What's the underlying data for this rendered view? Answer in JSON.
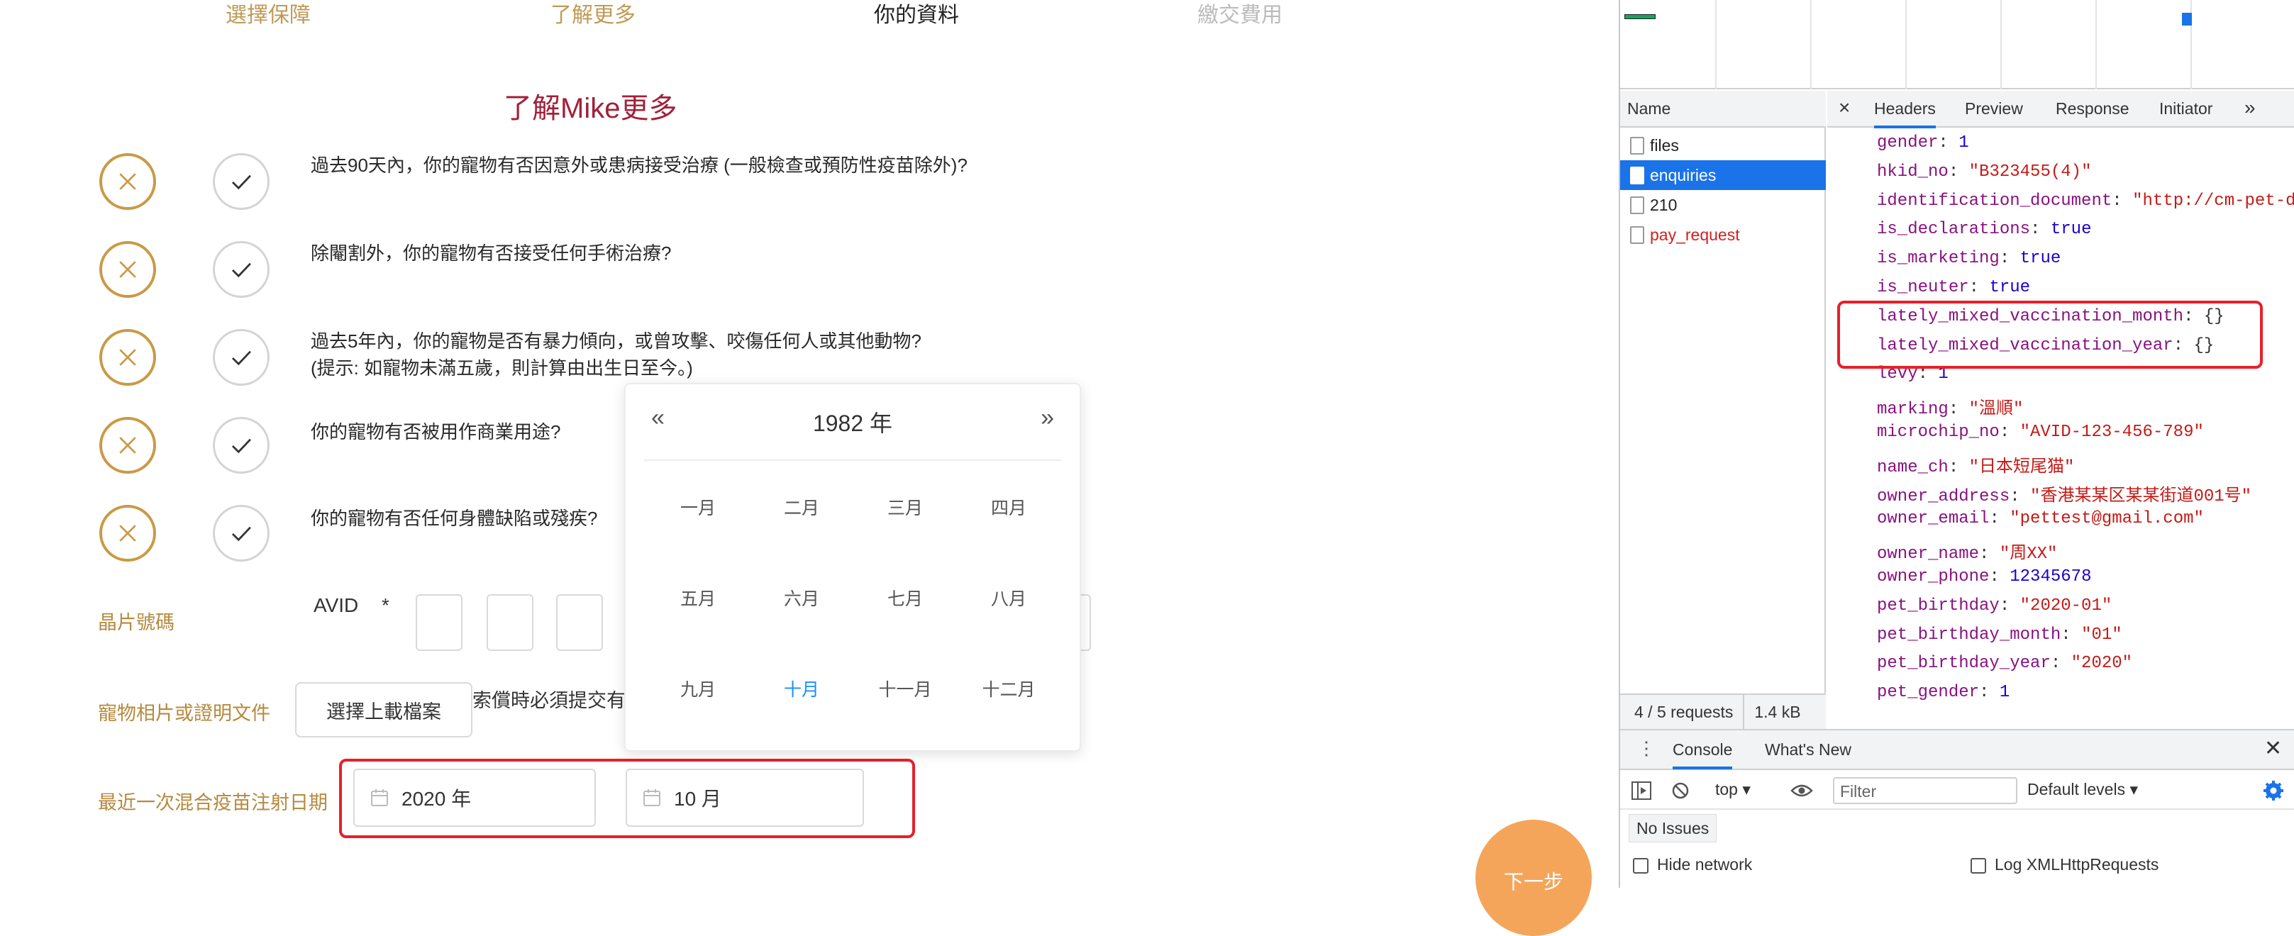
{
  "steps": [
    {
      "label": "選擇保障",
      "color": "#c09a56"
    },
    {
      "label": "了解更多",
      "color": "#c09a56"
    },
    {
      "label": "你的資料",
      "color": "#222222"
    },
    {
      "label": "繳交費用",
      "color": "#bbbbbb"
    }
  ],
  "section_title": "了解Mike更多",
  "questions": [
    {
      "line1": "過去90天內，你的寵物有否因意外或患病接受治療 (一般檢查或預防性疫苗除外)?"
    },
    {
      "line1": "除閹割外，你的寵物有否接受任何手術治療?"
    },
    {
      "line1": "過去5年內，你的寵物是否有暴力傾向，或曾攻擊、咬傷任何人或其他動物?",
      "line2": "(提示: 如寵物未滿五歲，則計算由出生日至今。)"
    },
    {
      "line1": "你的寵物有否被用作商業用途?"
    },
    {
      "line1": "你的寵物有否任何身體缺陷或殘疾?"
    }
  ],
  "fields": {
    "chip_label": "晶片號碼",
    "chip_prefix": "AVID",
    "chip_required": "*",
    "photo_label": "寵物相片或證明文件",
    "upload_button": "選擇上載檔案",
    "upload_note": "索償時必須提交有",
    "vaccine_label": "最近一次混合疫苗注射日期",
    "vaccine_year": "2020 年",
    "vaccine_month": "10 月"
  },
  "picker": {
    "prev": "«",
    "next": "»",
    "year": "1982 年",
    "months": [
      "一月",
      "二月",
      "三月",
      "四月",
      "五月",
      "六月",
      "七月",
      "八月",
      "九月",
      "十月",
      "十一月",
      "十二月"
    ],
    "selected_month": "十月"
  },
  "next_button": "下一步",
  "devtools": {
    "name_header": "Name",
    "requests": [
      {
        "name": "files",
        "state": "normal"
      },
      {
        "name": "enquiries",
        "state": "selected"
      },
      {
        "name": "210",
        "state": "normal"
      },
      {
        "name": "pay_request",
        "state": "error"
      }
    ],
    "summary_requests": "4 / 5 requests",
    "summary_size": "1.4 kB",
    "close": "×",
    "tabs": [
      "Headers",
      "Preview",
      "Response",
      "Initiator"
    ],
    "more_tabs": "»",
    "payload": [
      {
        "key": "gender",
        "value": "1",
        "type": "num"
      },
      {
        "key": "hkid_no",
        "value": "\"B323455(4)\"",
        "type": "str"
      },
      {
        "key": "identification_document",
        "value": "\"http://cm-pet-d",
        "type": "str"
      },
      {
        "key": "is_declarations",
        "value": "true",
        "type": "bool"
      },
      {
        "key": "is_marketing",
        "value": "true",
        "type": "bool"
      },
      {
        "key": "is_neuter",
        "value": "true",
        "type": "bool"
      },
      {
        "key": "lately_mixed_vaccination_month",
        "value": "{}",
        "type": "obj"
      },
      {
        "key": "lately_mixed_vaccination_year",
        "value": "{}",
        "type": "obj"
      },
      {
        "key": "levy",
        "value": "1",
        "type": "num"
      },
      {
        "key": "marking",
        "value": "\"溫順\"",
        "type": "str"
      },
      {
        "key": "microchip_no",
        "value": "\"AVID-123-456-789\"",
        "type": "str"
      },
      {
        "key": "name_ch",
        "value": "\"日本短尾猫\"",
        "type": "str"
      },
      {
        "key": "owner_address",
        "value": "\"香港某某区某某街道001号\"",
        "type": "str"
      },
      {
        "key": "owner_email",
        "value": "\"pettest@gmail.com\"",
        "type": "str"
      },
      {
        "key": "owner_name",
        "value": "\"周XX\"",
        "type": "str"
      },
      {
        "key": "owner_phone",
        "value": "12345678",
        "type": "num"
      },
      {
        "key": "pet_birthday",
        "value": "\"2020-01\"",
        "type": "str"
      },
      {
        "key": "pet_birthday_month",
        "value": "\"01\"",
        "type": "str"
      },
      {
        "key": "pet_birthday_year",
        "value": "\"2020\"",
        "type": "str"
      },
      {
        "key": "pet_gender",
        "value": "1",
        "type": "num"
      }
    ],
    "drawer_tabs": [
      "Console",
      "What's New"
    ],
    "context": "top",
    "filter_placeholder": "Filter",
    "levels": "Default levels",
    "no_issues": "No Issues",
    "hide_network": "Hide network",
    "log_xhr": "Log XMLHttpRequests"
  },
  "colors": {
    "accent_gold": "#c99a45",
    "title_red": "#a0213a",
    "highlight_red": "#e8202a",
    "devtools_blue": "#1a73e8",
    "next_orange": "#f5a55a"
  }
}
